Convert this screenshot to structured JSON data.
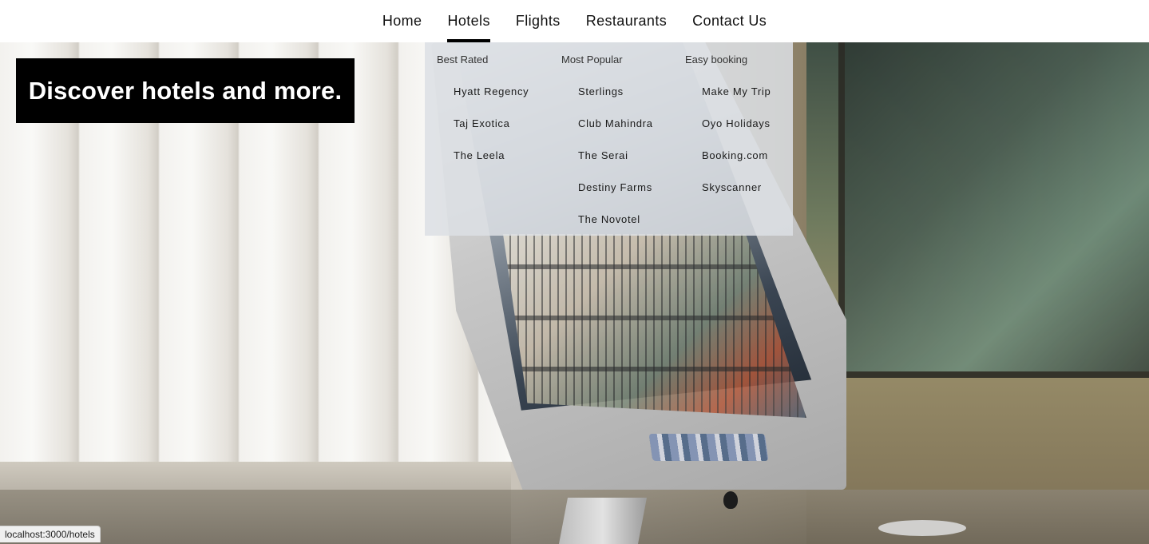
{
  "nav": {
    "items": [
      {
        "label": "Home",
        "active": false
      },
      {
        "label": "Hotels",
        "active": true
      },
      {
        "label": "Flights",
        "active": false
      },
      {
        "label": "Restaurants",
        "active": false
      },
      {
        "label": "Contact Us",
        "active": false
      }
    ]
  },
  "hero": {
    "title": "Discover hotels and more."
  },
  "mega_menu": {
    "columns": [
      {
        "heading": "Best Rated",
        "links": [
          "Hyatt Regency",
          "Taj Exotica",
          "The Leela"
        ]
      },
      {
        "heading": "Most Popular",
        "links": [
          "Sterlings",
          "Club Mahindra",
          "The Serai",
          "Destiny Farms",
          "The Novotel"
        ]
      },
      {
        "heading": "Easy booking",
        "links": [
          "Make My Trip",
          "Oyo Holidays",
          "Booking.com",
          "Skyscanner"
        ]
      }
    ]
  },
  "status_bar": {
    "url": "localhost:3000/hotels"
  },
  "colors": {
    "nav_active_underline": "#000000",
    "hero_title_bg": "#000000",
    "hero_title_text": "#ffffff"
  }
}
